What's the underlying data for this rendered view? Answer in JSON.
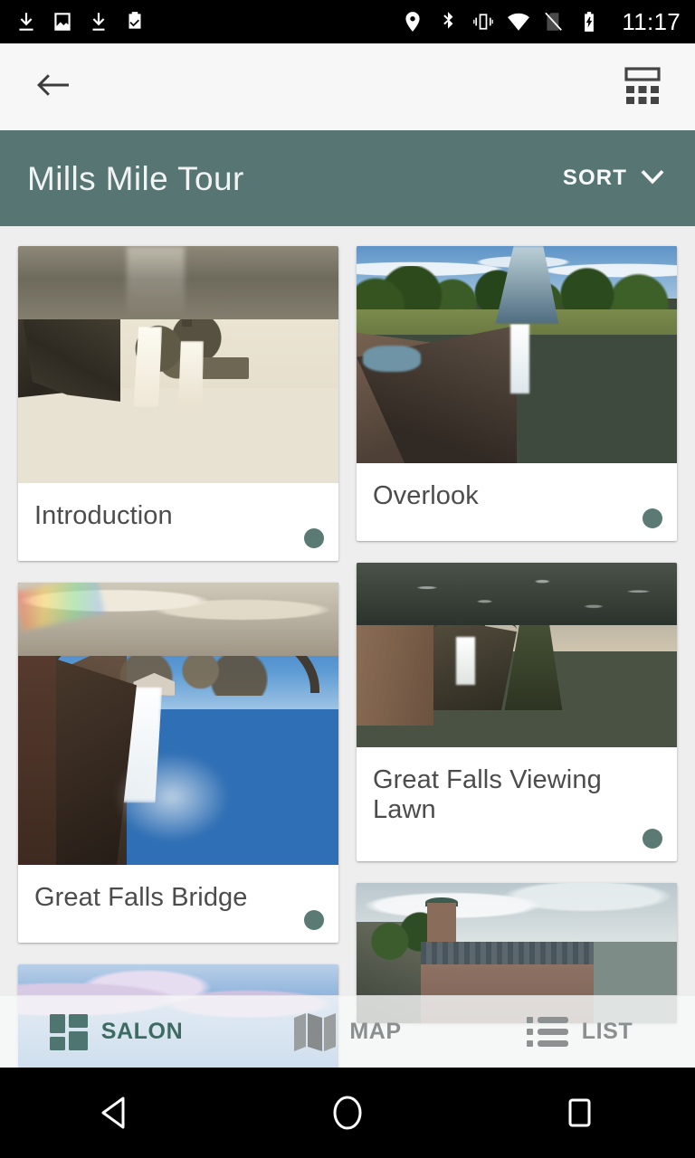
{
  "status_bar": {
    "time": "11:17",
    "left_icons": [
      "download-icon",
      "image-icon",
      "download-icon",
      "clipboard-check-icon"
    ],
    "right_icons": [
      "location-pin-icon",
      "bluetooth-icon",
      "vibrate-icon",
      "wifi-icon",
      "sim-off-icon",
      "battery-charging-icon"
    ]
  },
  "app_bar": {
    "back_icon": "arrow-left-icon",
    "view_toggle_icon": "grid-view-icon"
  },
  "header": {
    "title": "Mills Mile Tour",
    "sort_label": "SORT",
    "sort_chevron_icon": "chevron-down-icon",
    "background_color": "#577573"
  },
  "colors": {
    "accent_teal": "#577573",
    "dot_teal": "#5a7a73",
    "nav_active": "#3d6b60",
    "nav_inactive": "#8a8f90",
    "page_background": "#eeeeee",
    "card_background": "#ffffff",
    "title_text": "#4c4c4c"
  },
  "cards": {
    "left_column": [
      {
        "title": "Introduction",
        "image": "historic-sepia-waterfall-with-iron-bridge",
        "has_dot": true
      },
      {
        "title": "Great Falls Bridge",
        "image": "great-falls-bridge-with-rainbow",
        "has_dot": true
      },
      {
        "title": "",
        "image": "blue-sky-with-clouds",
        "has_dot": false
      }
    ],
    "right_column": [
      {
        "title": "Overlook",
        "image": "aerial-view-of-gorge-and-falls",
        "has_dot": true
      },
      {
        "title": "Great Falls Viewing Lawn",
        "image": "brick-building-and-river-at-dusk",
        "has_dot": true
      },
      {
        "title": "",
        "image": "historic-mill-building-with-tower",
        "has_dot": false
      }
    ]
  },
  "bottom_nav": {
    "items": [
      {
        "label": "SALON",
        "icon": "salon-grid-icon",
        "active": true
      },
      {
        "label": "MAP",
        "icon": "map-folded-icon",
        "active": false
      },
      {
        "label": "LIST",
        "icon": "list-bullet-icon",
        "active": false
      }
    ]
  },
  "android_nav": {
    "back": "back-triangle-icon",
    "home": "home-circle-icon",
    "recents": "recents-square-icon"
  }
}
